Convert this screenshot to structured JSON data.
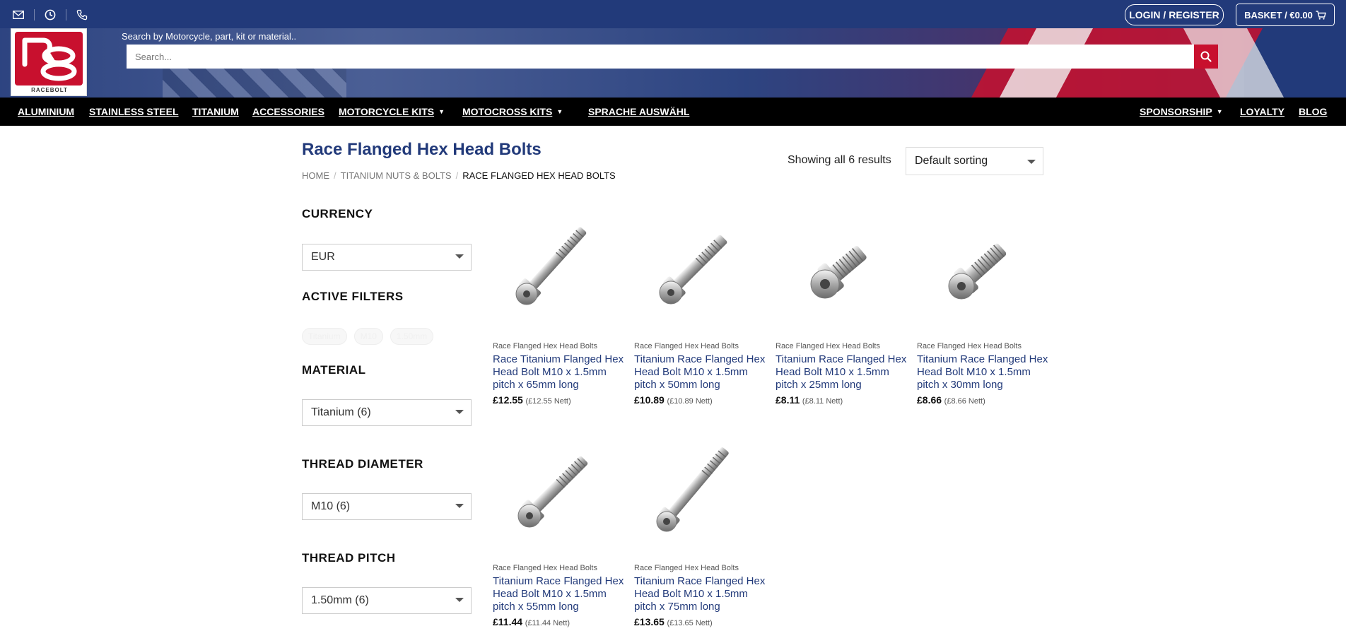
{
  "header": {
    "logo_text": "RACEBOLT",
    "search_label": "Search by Motorcycle, part, kit or material..",
    "search_placeholder": "Search...",
    "login_label": "LOGIN / REGISTER",
    "basket_label": "BASKET / €0.00"
  },
  "nav": {
    "items": [
      "ALUMINIUM",
      "STAINLESS STEEL",
      "TITANIUM",
      "ACCESSORIES",
      "MOTORCYCLE KITS",
      "MOTOCROSS KITS",
      "SPRACHE AUSWÄHL",
      "SPONSORSHIP",
      "LOYALTY",
      "BLOG"
    ]
  },
  "page": {
    "title": "Race Flanged Hex Head Bolts",
    "breadcrumb": [
      "HOME",
      "TITANIUM NUTS & BOLTS",
      "RACE FLANGED HEX HEAD BOLTS"
    ],
    "result_count": "Showing all 6 results",
    "sort_value": "Default sorting"
  },
  "sidebar": {
    "currency_title": "CURRENCY",
    "currency_value": "EUR",
    "active_filters_title": "ACTIVE FILTERS",
    "active_filters": [
      "Titanium",
      "M10",
      "1.50mm"
    ],
    "material_title": "MATERIAL",
    "material_value": "Titanium (6)",
    "thread_diameter_title": "THREAD DIAMETER",
    "thread_diameter_value": "M10 (6)",
    "thread_pitch_title": "THREAD PITCH",
    "thread_pitch_value": "1.50mm (6)"
  },
  "products": [
    {
      "category": "Race Flanged Hex Head Bolts",
      "name": "Race Titanium Flanged Hex Head Bolt M10 x 1.5mm pitch x 65mm long",
      "price": "£12.55",
      "nett": "(£12.55 Nett)"
    },
    {
      "category": "Race Flanged Hex Head Bolts",
      "name": "Titanium Race Flanged Hex Head Bolt M10 x 1.5mm pitch x 50mm long",
      "price": "£10.89",
      "nett": "(£10.89 Nett)"
    },
    {
      "category": "Race Flanged Hex Head Bolts",
      "name": "Titanium Race Flanged Hex Head Bolt M10 x 1.5mm pitch x 25mm long",
      "price": "£8.11",
      "nett": "(£8.11 Nett)"
    },
    {
      "category": "Race Flanged Hex Head Bolts",
      "name": "Titanium Race Flanged Hex Head Bolt M10 x 1.5mm pitch x 30mm long",
      "price": "£8.66",
      "nett": "(£8.66 Nett)"
    },
    {
      "category": "Race Flanged Hex Head Bolts",
      "name": "Titanium Race Flanged Hex Head Bolt M10 x 1.5mm pitch x 55mm long",
      "price": "£11.44",
      "nett": "(£11.44 Nett)"
    },
    {
      "category": "Race Flanged Hex Head Bolts",
      "name": "Titanium Race Flanged Hex Head Bolt M10 x 1.5mm pitch x 75mm long",
      "price": "£13.65",
      "nett": "(£13.65 Nett)"
    }
  ],
  "colors": {
    "brand_blue": "#223a7a",
    "brand_red": "#c8102e"
  }
}
